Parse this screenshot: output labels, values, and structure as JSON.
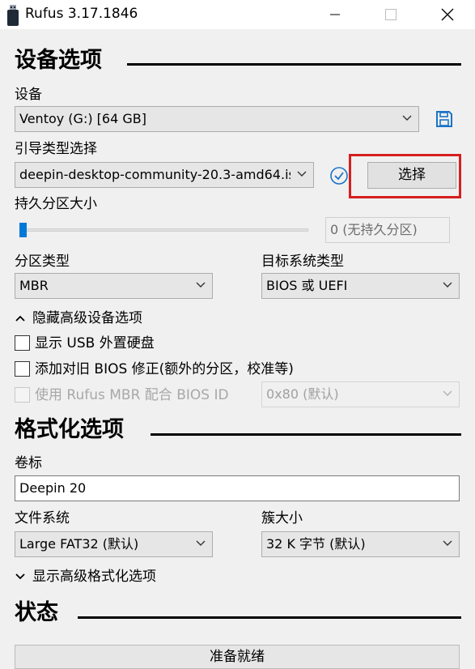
{
  "window": {
    "title": "Rufus 3.17.1846"
  },
  "sections": {
    "device_options": "设备选项",
    "format_options": "格式化选项",
    "status": "状态"
  },
  "device": {
    "label": "设备",
    "value": "Ventoy (G:) [64 GB]"
  },
  "boot": {
    "label": "引导类型选择",
    "value": "deepin-desktop-community-20.3-amd64.is",
    "select_label": "选择"
  },
  "persistent": {
    "label": "持久分区大小",
    "value": "0 (无持久分区)"
  },
  "partition_scheme": {
    "label": "分区类型",
    "value": "MBR"
  },
  "target_system": {
    "label": "目标系统类型",
    "value": "BIOS 或 UEFI"
  },
  "advanced_device": {
    "toggle_label": "隐藏高级设备选项",
    "list_usb_hdd": "显示 USB 外置硬盘",
    "old_bios_fixes": "添加对旧 BIOS 修正(额外的分区，校准等)",
    "rufus_mbr": "使用 Rufus MBR 配合 BIOS ID",
    "bios_id_value": "0x80 (默认)"
  },
  "volume": {
    "label": "卷标",
    "value": "Deepin 20"
  },
  "file_system": {
    "label": "文件系统",
    "value": "Large FAT32 (默认)"
  },
  "cluster_size": {
    "label": "簇大小",
    "value": "32 K 字节 (默认)"
  },
  "advanced_format": {
    "toggle_label": "显示高级格式化选项"
  },
  "status": {
    "text": "准备就绪"
  },
  "colors": {
    "accent": "#0078d7",
    "highlight_border": "#d61f1f"
  }
}
